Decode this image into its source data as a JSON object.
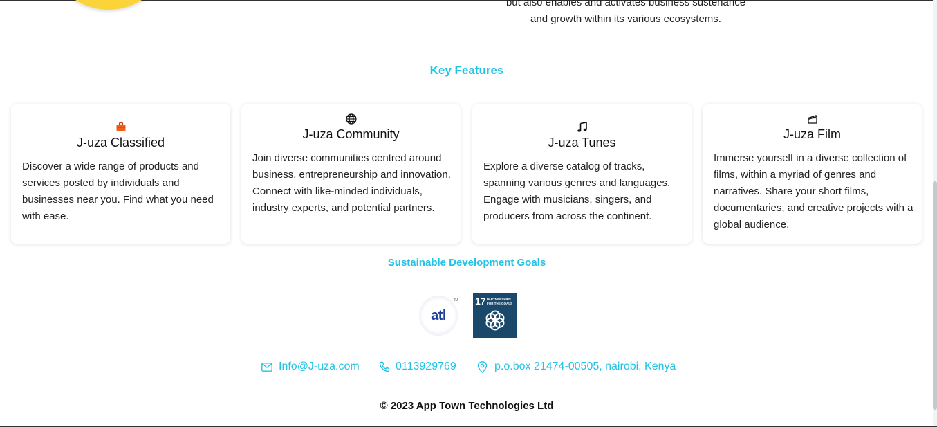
{
  "intro": {
    "line1": "but also enables and activates business sustenance",
    "line2": "and growth within its various ecosystems."
  },
  "key_features": {
    "title": "Key Features",
    "cards": [
      {
        "icon": "briefcase-icon",
        "title": "J-uza Classified",
        "description": "Discover a wide range of products and services posted by individuals and businesses near you. Find what you need with ease."
      },
      {
        "icon": "globe-icon",
        "title": "J-uza Community",
        "description": "Join diverse communities centred around business, entrepreneurship and innovation. Connect with like-minded individuals, industry experts, and potential partners."
      },
      {
        "icon": "music-note-icon",
        "title": "J-uza Tunes",
        "description": "Explore a diverse catalog of tracks, spanning various genres and languages. Engage with musicians, singers, and producers from across the continent."
      },
      {
        "icon": "clapperboard-icon",
        "title": "J-uza Film",
        "description": "Immerse yourself in a diverse collection of films, within a myriad of genres and narratives. Share your short films, documentaries, and creative projects with a global audience."
      }
    ]
  },
  "sdg": {
    "title": "Sustainable Development Goals",
    "atl_logo_text": "atl",
    "atl_tm": "TM",
    "goal_number": "17",
    "goal_text": "PARTNERSHIPS FOR THE GOALS"
  },
  "contact": {
    "email": "Info@J-uza.com",
    "phone": "0113929769",
    "address": "p.o.box 21474-00505, nairobi, Kenya"
  },
  "footer": {
    "copyright": "© 2023 App Town Technologies Ltd"
  },
  "colors": {
    "accent": "#22c3e6",
    "logo_yellow": "#fbd43a",
    "sdg_blue": "#19486a"
  }
}
